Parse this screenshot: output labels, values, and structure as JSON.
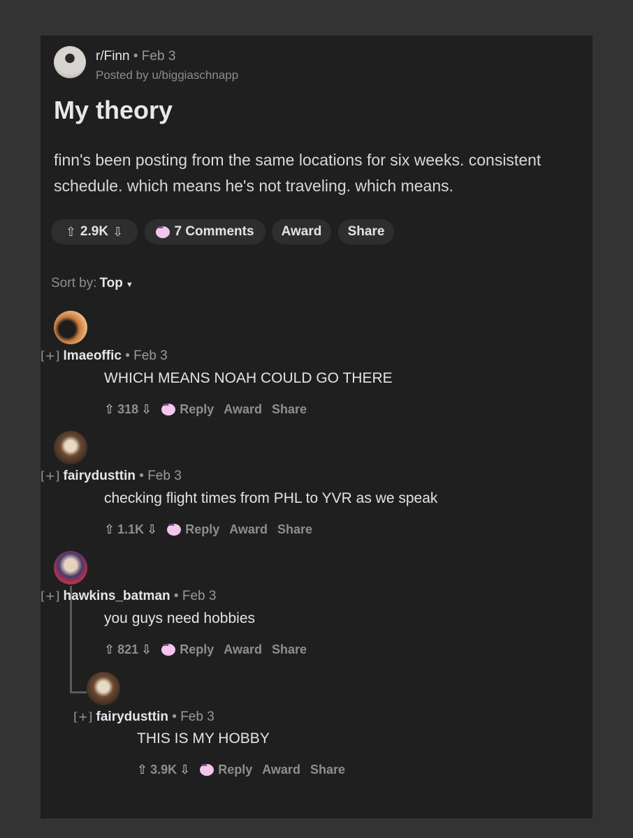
{
  "post": {
    "subreddit": "r/Finn",
    "date": "Feb 3",
    "posted_by": "Posted by u/biggiaschnapp",
    "title": "My theory",
    "body": "finn's been posting from the same locations for six weeks. consistent schedule. which means he's not traveling. which means.",
    "votes": "2.9K",
    "comments_label": "7 Comments",
    "award_label": "Award",
    "share_label": "Share"
  },
  "sort": {
    "label": "Sort by:",
    "value": "Top"
  },
  "comments": [
    {
      "expand": "[+]",
      "user": "Imaeoffic",
      "date": "Feb 3",
      "text": "WHICH MEANS NOAH COULD GO THERE",
      "votes": "318",
      "reply": "Reply",
      "award": "Award",
      "share": "Share"
    },
    {
      "expand": "[+]",
      "user": "fairydusttin",
      "date": "Feb 3",
      "text": "checking flight times from PHL to YVR as we speak",
      "votes": "1.1K",
      "reply": "Reply",
      "award": "Award",
      "share": "Share"
    },
    {
      "expand": "[+]",
      "user": "hawkins_batman",
      "date": "Feb 3",
      "text": "you guys need hobbies",
      "votes": "821",
      "reply": "Reply",
      "award": "Award",
      "share": "Share"
    },
    {
      "expand": "[+]",
      "user": "fairydusttin",
      "date": "Feb 3",
      "text": "THIS IS MY HOBBY",
      "votes": "3.9K",
      "reply": "Reply",
      "award": "Award",
      "share": "Share"
    }
  ],
  "icons": {
    "upvote": "up-arrow-icon",
    "downvote": "down-arrow-icon",
    "comment": "speech-bubble-icon"
  },
  "colors": {
    "background": "#333333",
    "card": "#1f1f1f",
    "pill": "#2e2e2e",
    "bubble": "#f3c6ee"
  }
}
